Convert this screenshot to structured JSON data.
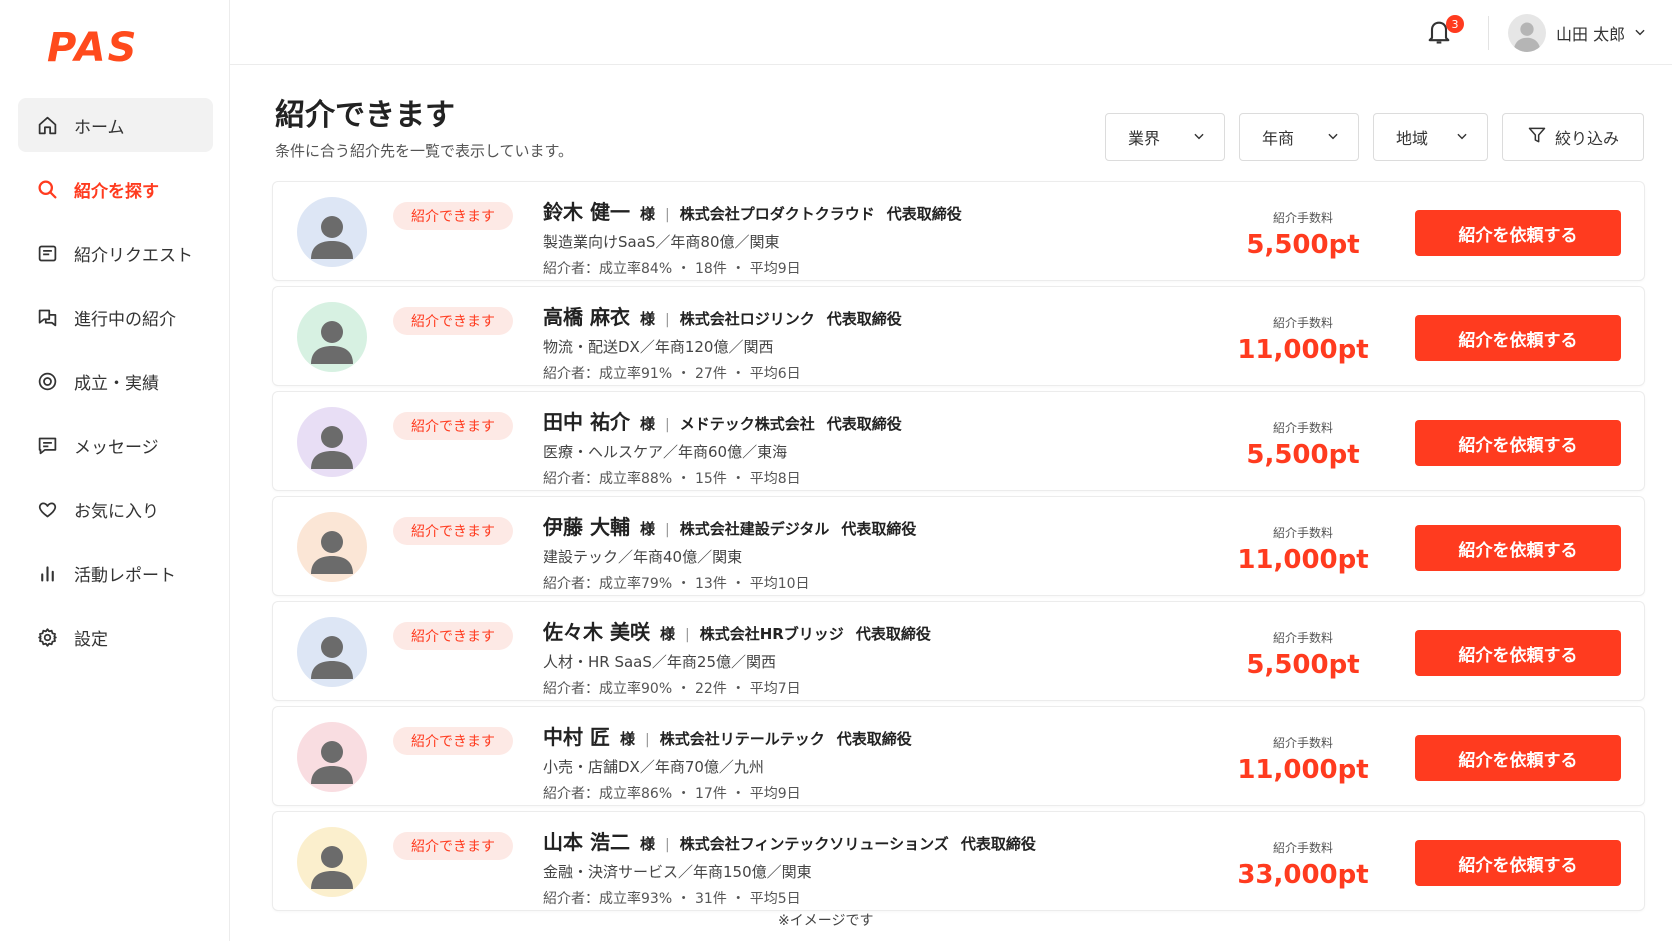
{
  "app": {
    "logo_text": "PAS"
  },
  "sidebar": {
    "items": [
      {
        "label": "ホーム",
        "icon": "home-icon"
      },
      {
        "label": "紹介を探す",
        "icon": "search-icon"
      },
      {
        "label": "紹介リクエスト",
        "icon": "request-icon"
      },
      {
        "label": "進行中の紹介",
        "icon": "progress-icon"
      },
      {
        "label": "成立・実績",
        "icon": "achievement-icon"
      },
      {
        "label": "メッセージ",
        "icon": "message-icon"
      },
      {
        "label": "お気に入り",
        "icon": "heart-icon"
      },
      {
        "label": "活動レポート",
        "icon": "chart-icon"
      },
      {
        "label": "設定",
        "icon": "gear-icon"
      }
    ]
  },
  "header": {
    "notification_count": "3",
    "user_name": "山田 太郎"
  },
  "main": {
    "title": "紹介できます",
    "subtitle": "条件に合う紹介先を一覧で表示しています。",
    "filters": {
      "industry": "業界",
      "revenue": "年商",
      "region": "地域",
      "refine": "絞り込み"
    },
    "fee_label": "紹介手数料",
    "tag_label": "紹介できます",
    "button_label": "紹介を依頼する",
    "sama": "様",
    "cards": [
      {
        "name": "鈴木 健一",
        "company": "株式会社プロダクトクラウド",
        "role": "代表取締役",
        "desc": "製造業向けSaaS／年商80億／関東",
        "stats": "紹介者：成立率84% ・ 18件 ・ 平均9日",
        "fee": "5,500pt",
        "avatar_color": "#dde6f5"
      },
      {
        "name": "高橋 麻衣",
        "company": "株式会社ロジリンク",
        "role": "代表取締役",
        "desc": "物流・配送DX／年商120億／関西",
        "stats": "紹介者：成立率91% ・ 27件 ・ 平均6日",
        "fee": "11,000pt",
        "avatar_color": "#d7f1e2"
      },
      {
        "name": "田中 祐介",
        "company": "メドテック株式会社",
        "role": "代表取締役",
        "desc": "医療・ヘルスケア／年商60億／東海",
        "stats": "紹介者：成立率88% ・ 15件 ・ 平均8日",
        "fee": "5,500pt",
        "avatar_color": "#e8def5"
      },
      {
        "name": "伊藤 大輔",
        "company": "株式会社建設デジタル",
        "role": "代表取締役",
        "desc": "建設テック／年商40億／関東",
        "stats": "紹介者：成立率79% ・ 13件 ・ 平均10日",
        "fee": "11,000pt",
        "avatar_color": "#fbe6d6"
      },
      {
        "name": "佐々木 美咲",
        "company": "株式会社HRブリッジ",
        "role": "代表取締役",
        "desc": "人材・HR SaaS／年商25億／関西",
        "stats": "紹介者：成立率90% ・ 22件 ・ 平均7日",
        "fee": "5,500pt",
        "avatar_color": "#dde6f5"
      },
      {
        "name": "中村 匠",
        "company": "株式会社リテールテック",
        "role": "代表取締役",
        "desc": "小売・店舗DX／年商70億／九州",
        "stats": "紹介者：成立率86% ・ 17件 ・ 平均9日",
        "fee": "11,000pt",
        "avatar_color": "#f9dde1"
      },
      {
        "name": "山本 浩二",
        "company": "株式会社フィンテックソリューションズ",
        "role": "代表取締役",
        "desc": "金融・決済サービス／年商150億／関東",
        "stats": "紹介者：成立率93% ・ 31件 ・ 平均5日",
        "fee": "33,000pt",
        "avatar_color": "#fbefcd"
      }
    ],
    "footnote": "※イメージです"
  }
}
